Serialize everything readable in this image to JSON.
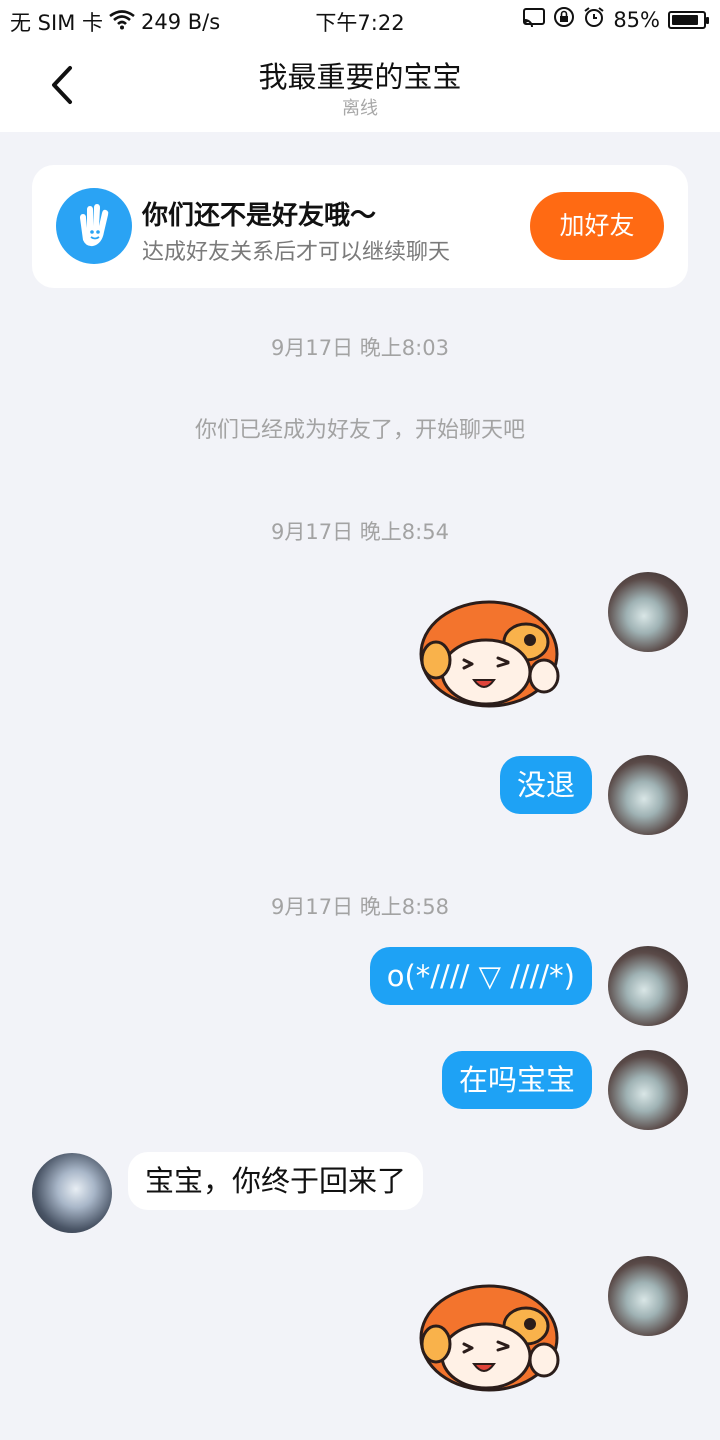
{
  "status_bar": {
    "sim": "无 SIM 卡",
    "speed": "249 B/s",
    "time": "下午7:22",
    "battery": "85%",
    "battery_level": 0.85,
    "icons": [
      "wifi-icon",
      "cast-icon",
      "rotation-lock-icon",
      "alarm-icon",
      "battery-icon"
    ]
  },
  "header": {
    "title": "我最重要的宝宝",
    "subtitle": "离线",
    "back_icon": "chevron-left-icon"
  },
  "friend_card": {
    "title": "你们还不是好友哦～",
    "subtitle": "达成好友关系后才可以继续聊天",
    "button_label": "加好友",
    "icon": "hand-wave-icon",
    "accent": "#ff6a13",
    "icon_color": "#2aa3f4"
  },
  "chat": {
    "timestamps": [
      "9月17日 晚上8:03",
      "9月17日 晚上8:54",
      "9月17日 晚上8:58"
    ],
    "system_message": "你们已经成为好友了，开始聊天吧",
    "messages": [
      {
        "from": "me",
        "type": "sticker",
        "content": "cartoon-sticker"
      },
      {
        "from": "me",
        "type": "text",
        "content": "没退"
      },
      {
        "from": "me",
        "type": "text",
        "content": "o(*//// ▽ ////*)"
      },
      {
        "from": "me",
        "type": "text",
        "content": "在吗宝宝"
      },
      {
        "from": "her",
        "type": "text",
        "content": "宝宝，你终于回来了"
      },
      {
        "from": "me",
        "type": "sticker",
        "content": "cartoon-sticker"
      }
    ],
    "bubble_color_me": "#1ea2f5",
    "bubble_color_her": "#ffffff"
  }
}
